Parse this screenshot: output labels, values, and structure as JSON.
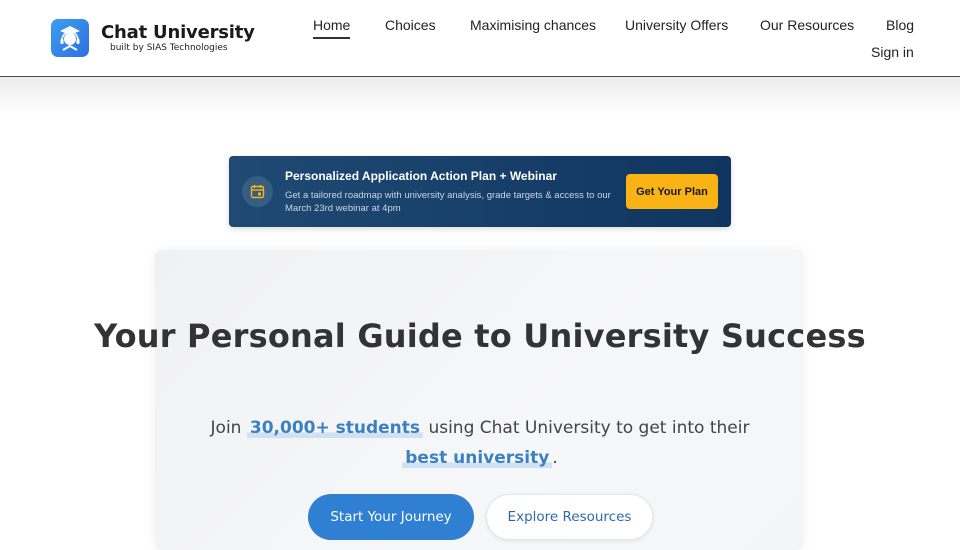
{
  "brand": {
    "name": "Chat University",
    "subtitle": "built by SIAS Technologies",
    "logo_icon": "graduate-headset-icon"
  },
  "nav": {
    "home": "Home",
    "choices": "Choices",
    "maximising": "Maximising chances",
    "offers": "University Offers",
    "resources": "Our Resources",
    "blog": "Blog",
    "signin": "Sign in"
  },
  "banner": {
    "icon": "calendar-icon",
    "title": "Personalized Application Action Plan + Webinar",
    "description": "Get a tailored roadmap with university analysis, grade targets & access to our March 23rd webinar at 4pm",
    "button": "Get Your Plan"
  },
  "hero": {
    "title": "Your Personal Guide to University Success",
    "sub_prefix": "Join",
    "sub_highlight_1": "30,000+ students",
    "sub_middle": "using Chat University to get into their",
    "sub_highlight_2": "best university",
    "sub_suffix": ".",
    "primary_button": "Start Your Journey",
    "secondary_button": "Explore Resources"
  },
  "colors": {
    "accent": "#2f7fd3",
    "banner_bg": "#0f3560",
    "cta_yellow": "#f9b314",
    "highlight_text": "#3b7fc4"
  }
}
